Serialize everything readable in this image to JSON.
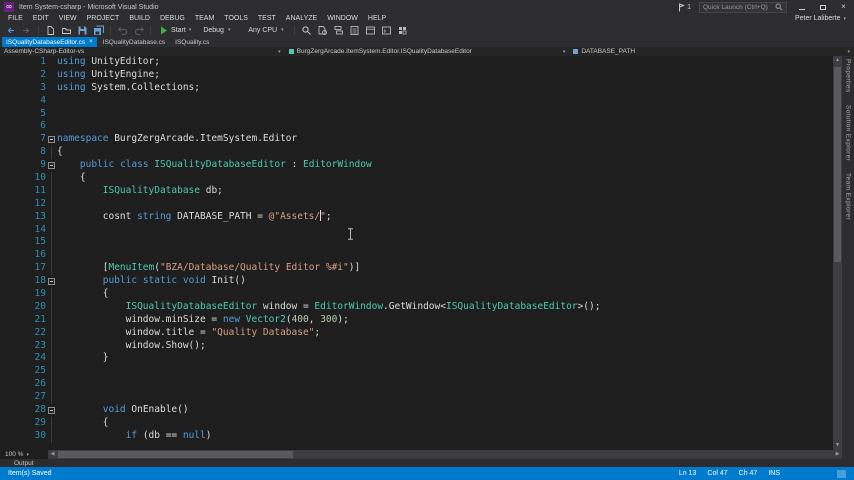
{
  "window": {
    "title": "Item System-csharp - Microsoft Visual Studio",
    "notification_count": "1",
    "quick_launch_placeholder": "Quick Launch (Ctrl+Q)",
    "user_name": "Peter Laliberte"
  },
  "menu": {
    "items": [
      "FILE",
      "EDIT",
      "VIEW",
      "PROJECT",
      "BUILD",
      "DEBUG",
      "TEAM",
      "TOOLS",
      "TEST",
      "ANALYZE",
      "WINDOW",
      "HELP"
    ]
  },
  "toolbar": {
    "start_label": "Start",
    "config_value": "Debug",
    "platform_value": "Any CPU"
  },
  "tabs": [
    {
      "label": "ISQualityDatabaseEditor.cs",
      "active": true
    },
    {
      "label": "ISQualityDatabase.cs",
      "active": false
    },
    {
      "label": "ISQuality.cs",
      "active": false
    }
  ],
  "navbar": {
    "project": "Assembly-CSharp-Editor-vs",
    "type_path": "BurgZergArcade.ItemSystem.Editor.ISQualityDatabaseEditor",
    "member": "DATABASE_PATH"
  },
  "editor": {
    "zoom_level": "100 %",
    "lines": [
      {
        "n": 1,
        "seg": [
          [
            "k",
            "using"
          ],
          [
            "d",
            " UnityEditor;"
          ]
        ]
      },
      {
        "n": 2,
        "seg": [
          [
            "k",
            "using"
          ],
          [
            "d",
            " UnityEngine;"
          ]
        ]
      },
      {
        "n": 3,
        "seg": [
          [
            "k",
            "using"
          ],
          [
            "d",
            " System.Collections;"
          ]
        ]
      },
      {
        "n": 4,
        "seg": []
      },
      {
        "n": 5,
        "seg": []
      },
      {
        "n": 6,
        "seg": []
      },
      {
        "n": 7,
        "fold": true,
        "seg": [
          [
            "k",
            "namespace"
          ],
          [
            "d",
            " BurgZergArcade.ItemSystem.Editor"
          ]
        ]
      },
      {
        "n": 8,
        "guide": true,
        "seg": [
          [
            "d",
            "{"
          ]
        ]
      },
      {
        "n": 9,
        "fold": true,
        "seg": [
          [
            "d",
            "    "
          ],
          [
            "k",
            "public"
          ],
          [
            "d",
            " "
          ],
          [
            "k",
            "class"
          ],
          [
            "d",
            " "
          ],
          [
            "t",
            "ISQualityDatabaseEditor"
          ],
          [
            "d",
            " : "
          ],
          [
            "t",
            "EditorWindow"
          ]
        ]
      },
      {
        "n": 10,
        "guide": true,
        "seg": [
          [
            "d",
            "    {"
          ]
        ]
      },
      {
        "n": 11,
        "guide": true,
        "seg": [
          [
            "d",
            "        "
          ],
          [
            "t",
            "ISQualityDatabase"
          ],
          [
            "d",
            " db;"
          ]
        ]
      },
      {
        "n": 12,
        "guide": true,
        "seg": []
      },
      {
        "n": 13,
        "guide": true,
        "seg": [
          [
            "d",
            "        cosnt "
          ],
          [
            "k",
            "string"
          ],
          [
            "d",
            " DATABASE_PATH = "
          ],
          [
            "s",
            "@\"Assets/"
          ],
          [
            "caret",
            ""
          ],
          [
            "s",
            "\""
          ],
          [
            "d",
            ";"
          ]
        ]
      },
      {
        "n": 14,
        "guide": true,
        "seg": []
      },
      {
        "n": 15,
        "guide": true,
        "seg": []
      },
      {
        "n": 16,
        "guide": true,
        "seg": []
      },
      {
        "n": 17,
        "guide": true,
        "seg": [
          [
            "d",
            "        ["
          ],
          [
            "t",
            "MenuItem"
          ],
          [
            "d",
            "("
          ],
          [
            "s",
            "\"BZA/Database/Quality Editor %#i\""
          ],
          [
            "d",
            ")]"
          ]
        ]
      },
      {
        "n": 18,
        "fold": true,
        "seg": [
          [
            "d",
            "        "
          ],
          [
            "k",
            "public"
          ],
          [
            "d",
            " "
          ],
          [
            "k",
            "static"
          ],
          [
            "d",
            " "
          ],
          [
            "k",
            "void"
          ],
          [
            "d",
            " Init()"
          ]
        ]
      },
      {
        "n": 19,
        "guide": true,
        "seg": [
          [
            "d",
            "        {"
          ]
        ]
      },
      {
        "n": 20,
        "guide": true,
        "seg": [
          [
            "d",
            "            "
          ],
          [
            "t",
            "ISQualityDatabaseEditor"
          ],
          [
            "d",
            " window = "
          ],
          [
            "t",
            "EditorWindow"
          ],
          [
            "d",
            ".GetWindow<"
          ],
          [
            "t",
            "ISQualityDatabaseEditor"
          ],
          [
            "d",
            ">();"
          ]
        ]
      },
      {
        "n": 21,
        "guide": true,
        "seg": [
          [
            "d",
            "            window.minSize = "
          ],
          [
            "k",
            "new"
          ],
          [
            "d",
            " "
          ],
          [
            "t",
            "Vector2"
          ],
          [
            "d",
            "("
          ],
          [
            "num",
            "400"
          ],
          [
            "d",
            ", "
          ],
          [
            "num",
            "300"
          ],
          [
            "d",
            ");"
          ]
        ]
      },
      {
        "n": 22,
        "guide": true,
        "seg": [
          [
            "d",
            "            window.title = "
          ],
          [
            "s",
            "\"Quality Database\""
          ],
          [
            "d",
            ";"
          ]
        ]
      },
      {
        "n": 23,
        "guide": true,
        "seg": [
          [
            "d",
            "            window.Show();"
          ]
        ]
      },
      {
        "n": 24,
        "guide": true,
        "seg": [
          [
            "d",
            "        }"
          ]
        ]
      },
      {
        "n": 25,
        "guide": true,
        "seg": []
      },
      {
        "n": 26,
        "guide": true,
        "seg": []
      },
      {
        "n": 27,
        "guide": true,
        "seg": []
      },
      {
        "n": 28,
        "fold": true,
        "seg": [
          [
            "d",
            "        "
          ],
          [
            "k",
            "void"
          ],
          [
            "d",
            " OnEnable()"
          ]
        ]
      },
      {
        "n": 29,
        "guide": true,
        "seg": [
          [
            "d",
            "        {"
          ]
        ]
      },
      {
        "n": 30,
        "guide": true,
        "seg": [
          [
            "d",
            "            "
          ],
          [
            "k",
            "if"
          ],
          [
            "d",
            " (db == "
          ],
          [
            "k",
            "null"
          ],
          [
            "d",
            ")"
          ]
        ]
      }
    ]
  },
  "side_panels": {
    "tabs": [
      "Properties",
      "Solution Explorer",
      "Team Explorer"
    ]
  },
  "bottom": {
    "output_label": "Output"
  },
  "status_bar": {
    "message": "Item(s) Saved",
    "line": "Ln 13",
    "column": "Col 47",
    "character": "Ch 47",
    "mode": "INS"
  },
  "colors": {
    "accent": "#007acc",
    "chrome_background": "#2d2d30",
    "editor_background": "#1e1e1e",
    "keyword": "#569cd6",
    "user_type": "#4ec9b0",
    "string": "#d69d85",
    "number": "#b5cea8",
    "line_number": "#2b91af",
    "status_background": "#007acc"
  }
}
